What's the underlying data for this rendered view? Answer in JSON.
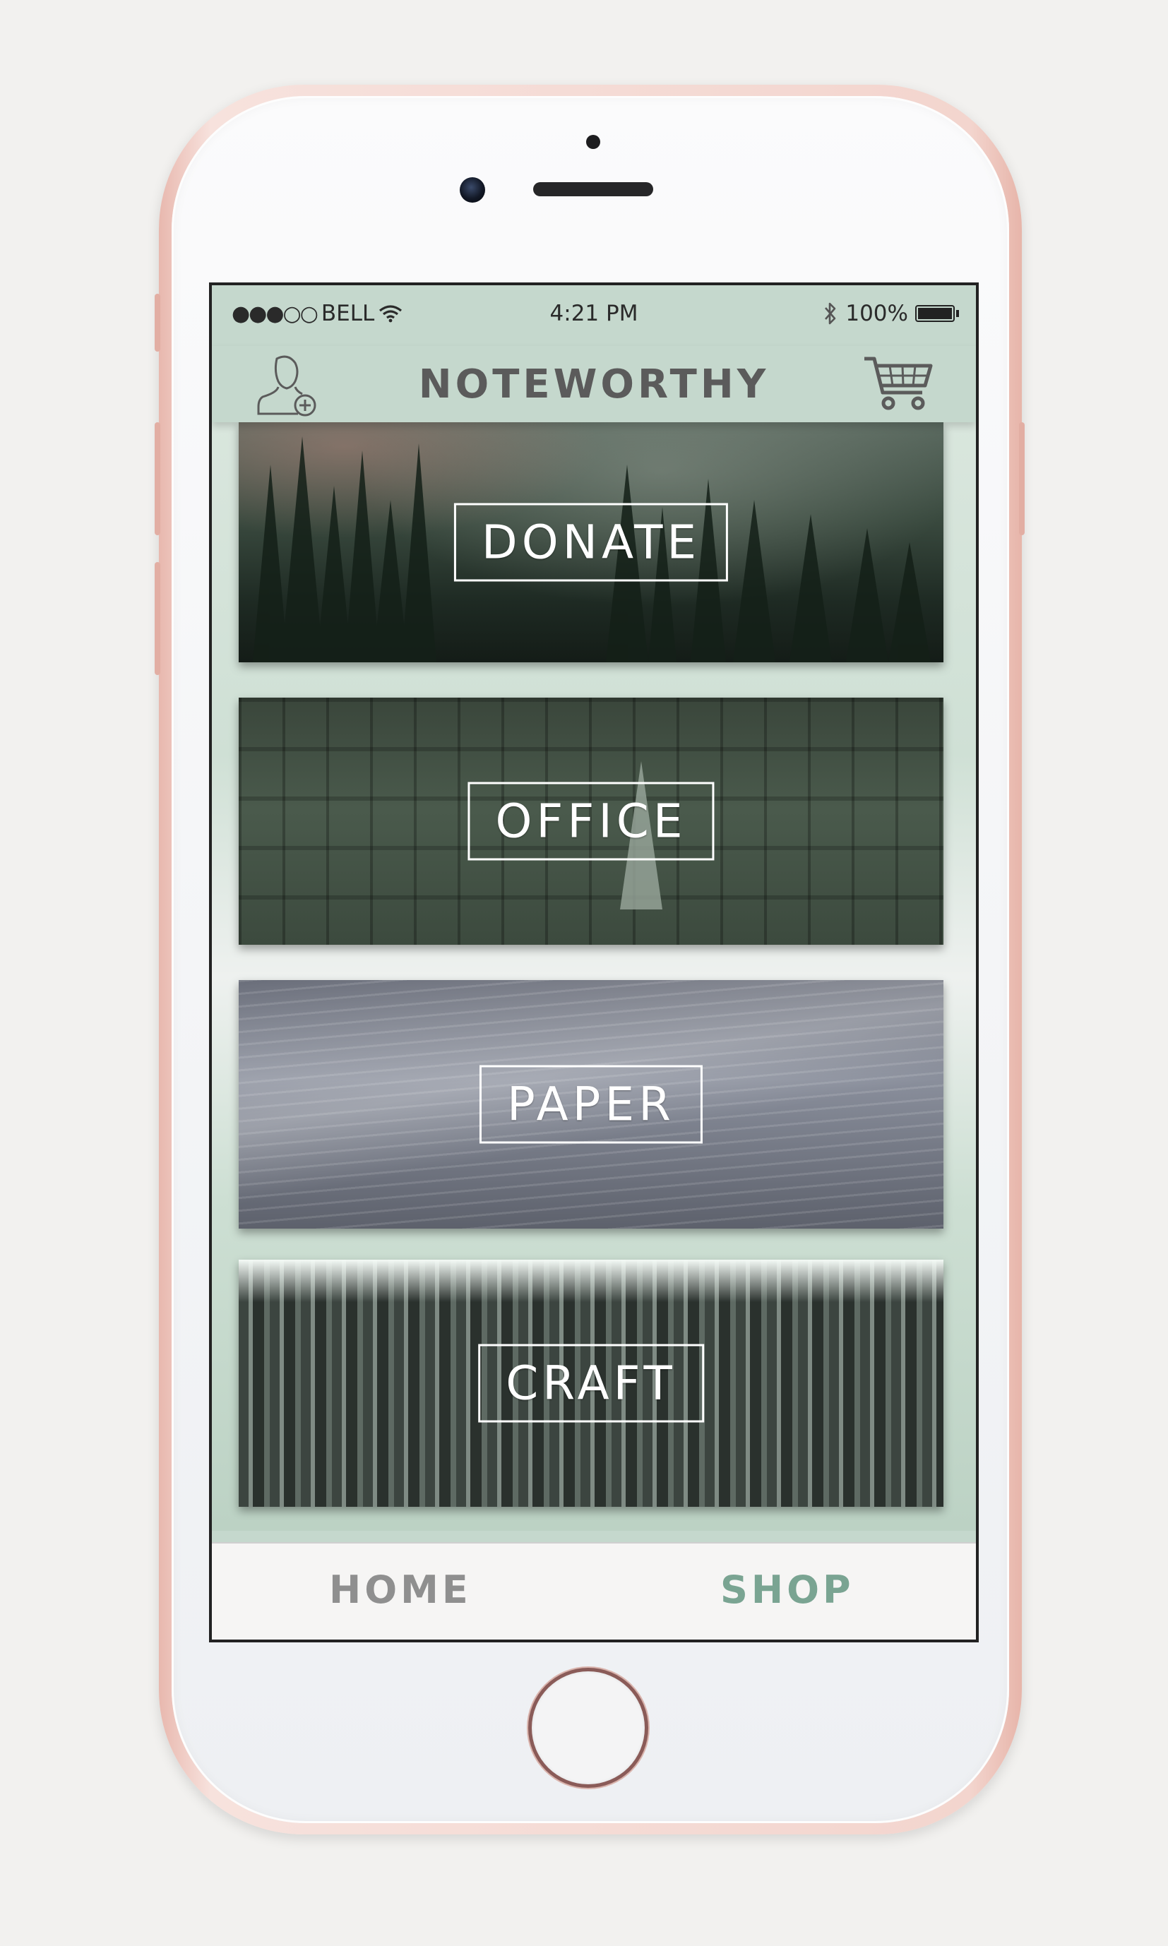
{
  "status_bar": {
    "signal": "●●●○○",
    "carrier": "BELL",
    "time": "4:21 PM",
    "bluetooth": "bluetooth-icon",
    "battery_percent": "100%"
  },
  "nav": {
    "title": "NOTEWORTHY",
    "left_icon": "add-user-icon",
    "right_icon": "shopping-cart-icon"
  },
  "categories": [
    {
      "label": "DONATE",
      "image": "misty forest"
    },
    {
      "label": "OFFICE",
      "image": "pencils"
    },
    {
      "label": "PAPER",
      "image": "paper stack"
    },
    {
      "label": "CRAFT",
      "image": "paint brushes"
    }
  ],
  "tabs": [
    {
      "label": "HOME",
      "active": false
    },
    {
      "label": "SHOP",
      "active": true
    }
  ],
  "colors": {
    "header_bg": "#c5d8cd",
    "title_text": "#5b5b5b",
    "tab_inactive": "#8f8f8f",
    "tab_active": "#7aa492",
    "phone_frame": "#f0cdc6"
  }
}
